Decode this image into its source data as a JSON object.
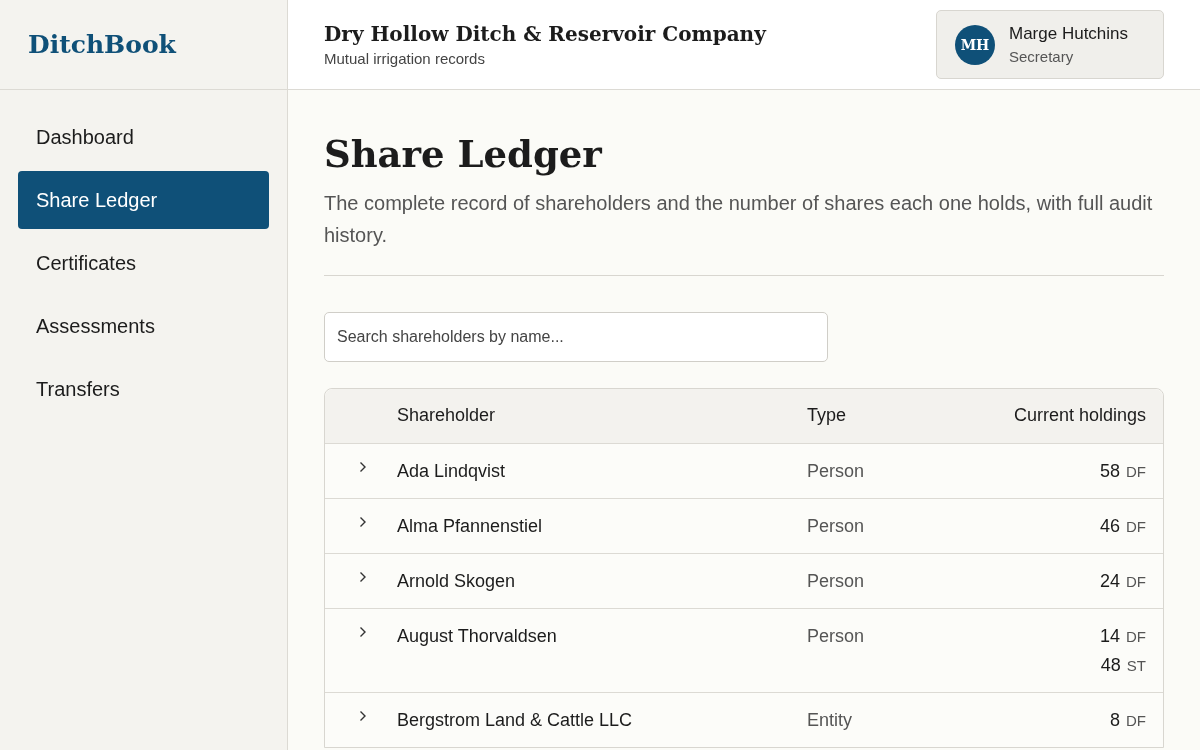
{
  "brand": "DitchBook",
  "header": {
    "title": "Dry Hollow Ditch & Reservoir Company",
    "subtitle": "Mutual irrigation records"
  },
  "user": {
    "initials": "MH",
    "name": "Marge Hutchins",
    "role": "Secretary"
  },
  "sidebar": {
    "items": [
      {
        "label": "Dashboard",
        "selected": false
      },
      {
        "label": "Share Ledger",
        "selected": true
      },
      {
        "label": "Certificates",
        "selected": false
      },
      {
        "label": "Assessments",
        "selected": false
      },
      {
        "label": "Transfers",
        "selected": false
      }
    ]
  },
  "page": {
    "title": "Share Ledger",
    "description": "The complete record of shareholders and the number of shares each one holds, with full audit history."
  },
  "search": {
    "placeholder": "Search shareholders by name..."
  },
  "table": {
    "columns": [
      "Shareholder",
      "Type",
      "Current holdings"
    ],
    "rows": [
      {
        "name": "Ada Lindqvist",
        "type": "Person",
        "expanded": false,
        "holdings": [
          {
            "amount": "58",
            "unit": "DF"
          }
        ]
      },
      {
        "name": "Alma Pfannenstiel",
        "type": "Person",
        "expanded": false,
        "holdings": [
          {
            "amount": "46",
            "unit": "DF"
          }
        ]
      },
      {
        "name": "Arnold Skogen",
        "type": "Person",
        "expanded": false,
        "holdings": [
          {
            "amount": "24",
            "unit": "DF"
          }
        ]
      },
      {
        "name": "August Thorvaldsen",
        "type": "Person",
        "expanded": false,
        "holdings": [
          {
            "amount": "14",
            "unit": "DF"
          },
          {
            "amount": "48",
            "unit": "ST"
          }
        ]
      },
      {
        "name": "Bergstrom Land & Cattle LLC",
        "type": "Entity",
        "expanded": false,
        "holdings": [
          {
            "amount": "8",
            "unit": "DF"
          }
        ]
      }
    ]
  }
}
